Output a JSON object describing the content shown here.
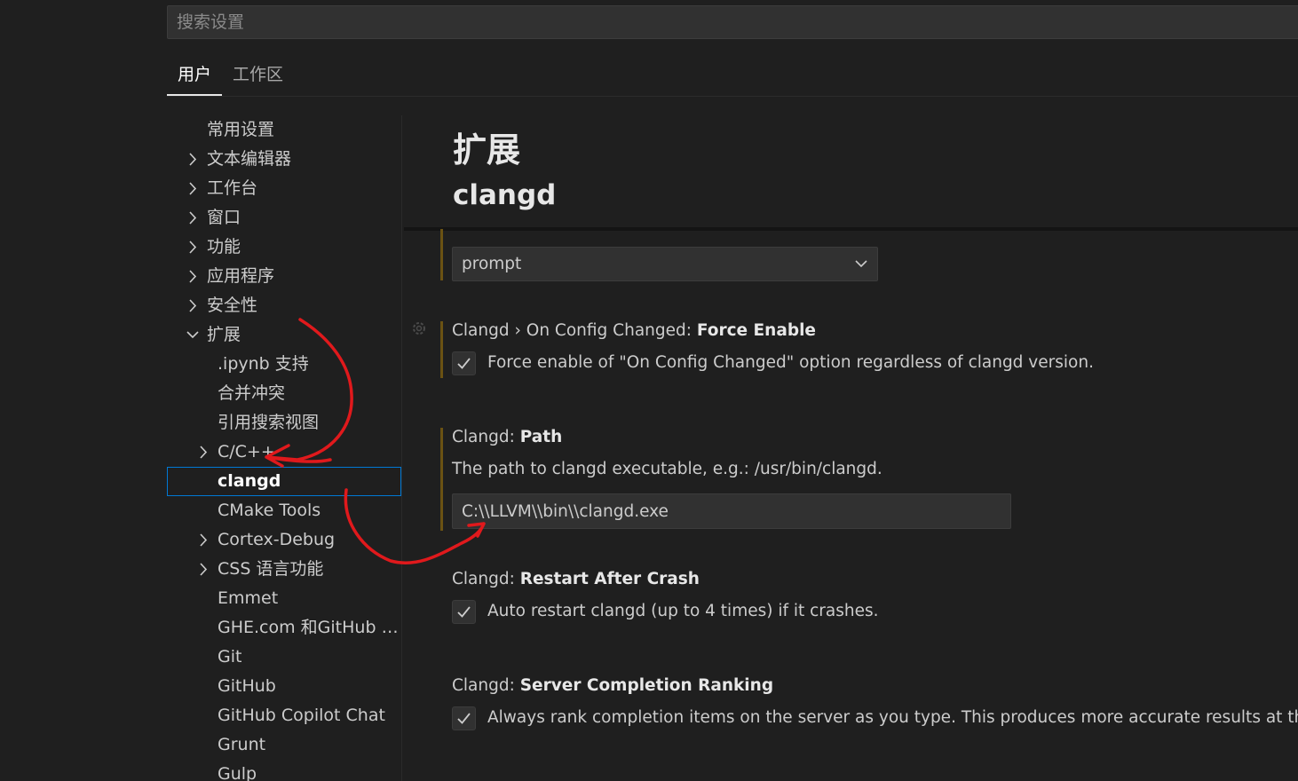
{
  "search": {
    "placeholder": "搜索设置"
  },
  "tabs": [
    {
      "label": "用户",
      "active": true
    },
    {
      "label": "工作区",
      "active": false
    }
  ],
  "toc": [
    {
      "label": "常用设置",
      "level": 0,
      "chevron": "none"
    },
    {
      "label": "文本编辑器",
      "level": 0,
      "chevron": "right"
    },
    {
      "label": "工作台",
      "level": 0,
      "chevron": "right"
    },
    {
      "label": "窗口",
      "level": 0,
      "chevron": "right"
    },
    {
      "label": "功能",
      "level": 0,
      "chevron": "right"
    },
    {
      "label": "应用程序",
      "level": 0,
      "chevron": "right"
    },
    {
      "label": "安全性",
      "level": 0,
      "chevron": "right"
    },
    {
      "label": "扩展",
      "level": 0,
      "chevron": "down"
    },
    {
      "label": ".ipynb 支持",
      "level": 1,
      "chevron": "none"
    },
    {
      "label": "合并冲突",
      "level": 1,
      "chevron": "none"
    },
    {
      "label": "引用搜索视图",
      "level": 1,
      "chevron": "none"
    },
    {
      "label": "C/C++",
      "level": 1,
      "chevron": "right"
    },
    {
      "label": "clangd",
      "level": 1,
      "chevron": "none",
      "selected": true
    },
    {
      "label": "CMake Tools",
      "level": 1,
      "chevron": "none"
    },
    {
      "label": "Cortex-Debug",
      "level": 1,
      "chevron": "right"
    },
    {
      "label": "CSS 语言功能",
      "level": 1,
      "chevron": "right"
    },
    {
      "label": "Emmet",
      "level": 1,
      "chevron": "none"
    },
    {
      "label": "GHE.com 和GitHub En...",
      "level": 1,
      "chevron": "none"
    },
    {
      "label": "Git",
      "level": 1,
      "chevron": "none"
    },
    {
      "label": "GitHub",
      "level": 1,
      "chevron": "none"
    },
    {
      "label": "GitHub Copilot Chat",
      "level": 1,
      "chevron": "none"
    },
    {
      "label": "Grunt",
      "level": 1,
      "chevron": "none"
    },
    {
      "label": "Gulp",
      "level": 1,
      "chevron": "none"
    }
  ],
  "content": {
    "heading": "扩展",
    "subheading": "clangd",
    "on_config_changed": {
      "value": "prompt"
    },
    "force_enable": {
      "prefix": "Clangd › On Config Changed: ",
      "name": "Force Enable",
      "checked": true,
      "label": "Force enable of \"On Config Changed\" option regardless of clangd version."
    },
    "path": {
      "prefix": "Clangd: ",
      "name": "Path",
      "description": "The path to clangd executable, e.g.: /usr/bin/clangd.",
      "value": "C:\\\\LLVM\\\\bin\\\\clangd.exe"
    },
    "restart_after_crash": {
      "prefix": "Clangd: ",
      "name": "Restart After Crash",
      "checked": true,
      "label": "Auto restart clangd (up to 4 times) if it crashes."
    },
    "server_completion_ranking": {
      "prefix": "Clangd: ",
      "name": "Server Completion Ranking",
      "checked": true,
      "label": "Always rank completion items on the server as you type. This produces more accurate results at the cost of"
    }
  },
  "colors": {
    "background": "#1f1f1f",
    "selection_outline": "#0078d4",
    "modified_bar": "#6b5213",
    "annotation": "#e0191c"
  },
  "icons": {
    "toc_collapsed": "chevron-right-icon",
    "toc_expanded": "chevron-down-icon",
    "dropdown": "chevron-down-icon",
    "checkbox": "check-icon",
    "settings_gear": "gear-icon"
  }
}
